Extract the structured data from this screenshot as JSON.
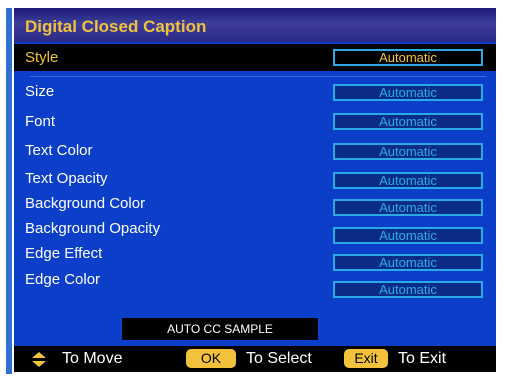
{
  "menu": {
    "title": "Digital Closed Caption",
    "items": [
      {
        "label": "Style",
        "value": "Automatic",
        "selected": true
      },
      {
        "label": "Size",
        "value": "Automatic"
      },
      {
        "label": "Font",
        "value": "Automatic"
      },
      {
        "label": "Text Color",
        "value": "Automatic"
      },
      {
        "label": "Text Opacity",
        "value": "Automatic"
      },
      {
        "label": "Background Color",
        "value": "Automatic"
      },
      {
        "label": "Background Opacity",
        "value": "Automatic"
      },
      {
        "label": "Edge Effect",
        "value": "Automatic"
      },
      {
        "label": "Edge Color",
        "value": "Automatic"
      }
    ],
    "sample_text": "AUTO CC SAMPLE"
  },
  "footer": {
    "move_icon": "up-down-arrow-icon",
    "move_label": "To Move",
    "ok_key": "OK",
    "select_label": "To Select",
    "exit_key": "Exit",
    "exit_label": "To Exit"
  },
  "colors": {
    "panel_blue": "#0c3fc9",
    "accent_yellow": "#f2c23c",
    "value_cyan": "#2aa9e8",
    "black": "#000000"
  }
}
